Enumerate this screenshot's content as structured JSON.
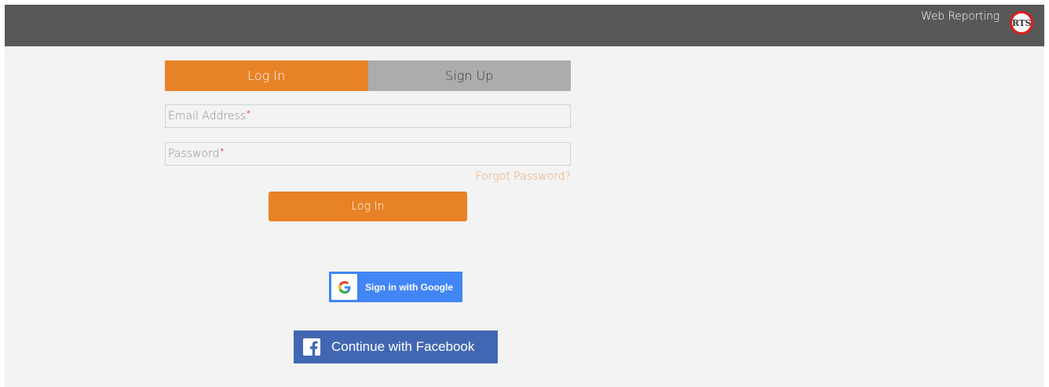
{
  "header": {
    "brand_text": "Web Reporting",
    "logo_text": "RTS"
  },
  "tabs": [
    {
      "label": "Log In",
      "active": true
    },
    {
      "label": "Sign Up",
      "active": false
    }
  ],
  "form": {
    "email_placeholder": "Email Address",
    "password_placeholder": "Password",
    "required_marker": "*",
    "forgot_password": "Forgot Password?",
    "login_button": "Log In"
  },
  "social": {
    "google_label": "Sign in with Google",
    "facebook_label": "Continue with Facebook"
  },
  "colors": {
    "accent": "#e88226",
    "header_bg": "#585858",
    "google_blue": "#4285f4",
    "facebook_blue": "#4267b2"
  }
}
